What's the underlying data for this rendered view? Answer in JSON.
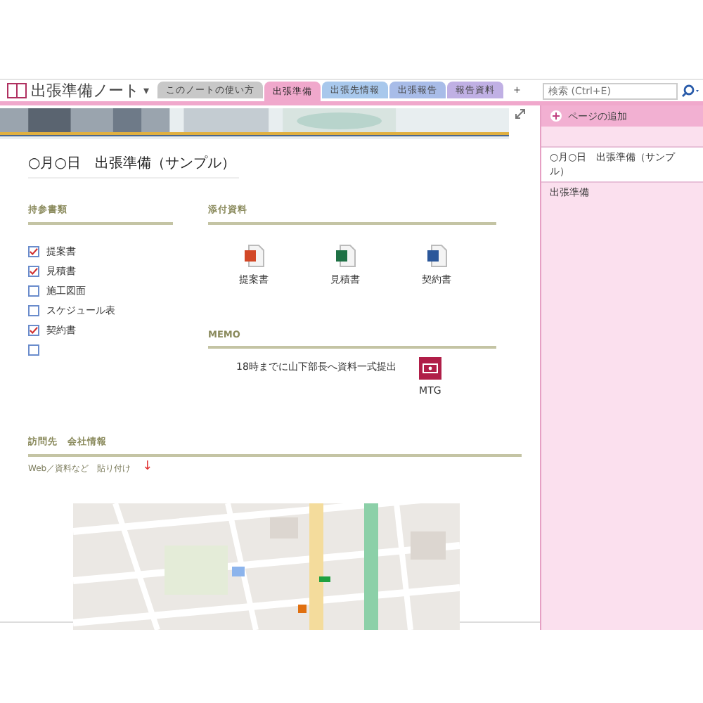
{
  "notebook": {
    "title": "出張準備ノート",
    "caret": "▾"
  },
  "tabs": [
    {
      "label": "このノートの使い方",
      "selected": false,
      "color": "#c8c8c8"
    },
    {
      "label": "出張準備",
      "selected": true,
      "color": "#f0a8cc"
    },
    {
      "label": "出張先情報",
      "selected": false,
      "color": "#a8c8ec"
    },
    {
      "label": "出張報告",
      "selected": false,
      "color": "#a8bce8"
    },
    {
      "label": "報告資料",
      "selected": false,
      "color": "#c0b0e4"
    },
    {
      "label": "+",
      "selected": false,
      "color": "#ffffff"
    }
  ],
  "search": {
    "placeholder": "検索 (Ctrl+E)"
  },
  "page": {
    "title": "○月○日　出張準備（サンプル）",
    "checklist": {
      "heading": "持参書類",
      "items": [
        {
          "label": "提案書",
          "checked": true
        },
        {
          "label": "見積書",
          "checked": true
        },
        {
          "label": "施工図面",
          "checked": false
        },
        {
          "label": "スケジュール表",
          "checked": false
        },
        {
          "label": "契約書",
          "checked": true
        },
        {
          "checked": false
        }
      ]
    },
    "attachments": {
      "heading": "添付資料",
      "files": [
        {
          "kind": "powerpoint",
          "label": "提案書"
        },
        {
          "kind": "excel",
          "label": "見積書"
        },
        {
          "kind": "word",
          "label": "契約書"
        }
      ]
    },
    "memo": {
      "heading": "MEMO",
      "text": "18時までに山下部長へ資料一式提出",
      "attachment": {
        "kind": "video",
        "label": "MTG"
      }
    },
    "visit": {
      "heading": "訪問先　会社情報",
      "note": "Web／資料など　貼り付け",
      "arrow": "↓"
    }
  },
  "pages_pane": {
    "add_label": "ページの追加",
    "pages": [
      {
        "title": "○月○日　出張準備（サンプル）",
        "selected": true
      },
      {
        "title": "出張準備",
        "selected": false
      }
    ]
  }
}
